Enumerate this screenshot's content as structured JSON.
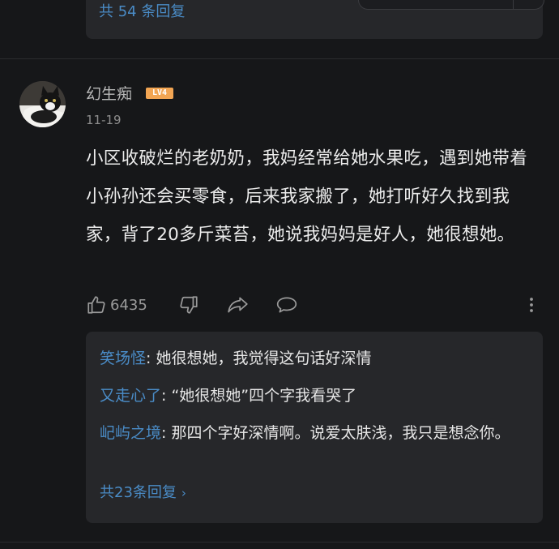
{
  "prev_comment": {
    "reply_count_label": "共 54 条回复"
  },
  "comment": {
    "username": "幻生痴",
    "level": "LV4",
    "date": "11-19",
    "content": "小区收破烂的老奶奶，我妈经常给她水果吃，遇到她带着小孙孙还会买零食，后来我家搬了，她打听好久找到我家，背了20多斤菜苔，她说我妈妈是好人，她很想她。",
    "like_count": "6435",
    "replies": [
      {
        "nick": "笑场怪",
        "text": ": 她很想她，我觉得这句话好深情"
      },
      {
        "nick": "又走心了",
        "text": ": “她很想她”四个字我看哭了"
      },
      {
        "nick": "屺屿之境",
        "text": ": 那四个字好深情啊。说爱太肤浅，我只是想念你。"
      }
    ],
    "more_replies_label": "共23条回复",
    "icons": {
      "like": "thumbs-up-icon",
      "dislike": "thumbs-down-icon",
      "share": "share-icon",
      "reply": "comment-icon",
      "more": "more-vertical-icon"
    }
  },
  "colors": {
    "background": "#161719",
    "reply_box": "#26272a",
    "link_blue": "#4a8cc7",
    "level_badge": "#f2a553",
    "accent_pink": "#e64a7b"
  }
}
